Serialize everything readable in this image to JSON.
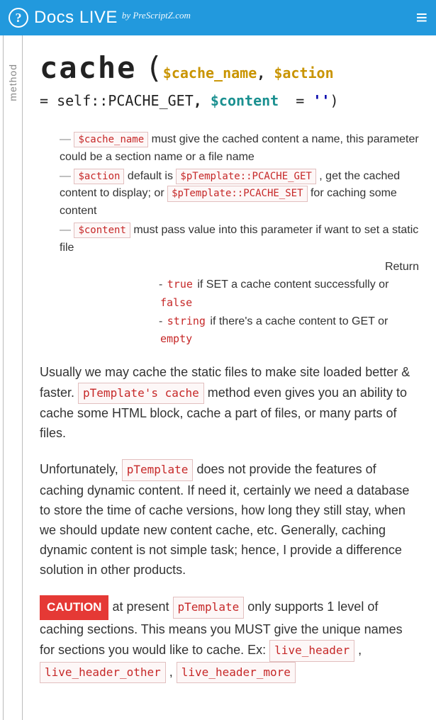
{
  "header": {
    "brand": "Docs LIVE",
    "byline": "by PreScriptZ.com",
    "question_glyph": "?",
    "menu_glyph": "≡"
  },
  "sidebar": {
    "label": "method"
  },
  "signature": {
    "name": "cache",
    "arg1": "$cache_name",
    "comma1": ",",
    "arg2": "$action",
    "eq1": "=",
    "self": "self::",
    "const1": "PCACHE_GET",
    "comma2": ",",
    "arg3": "$content",
    "eq2": "=",
    "strlit": "''",
    "close": ")"
  },
  "params": {
    "p1_code": "$cache_name",
    "p1_text": " must give the cached content a name, this parameter could be a section name or a file name",
    "p2_code": "$action",
    "p2_a": " default is ",
    "p2_code2": "$pTemplate::PCACHE_GET",
    "p2_b": " , get the cached content to display; or ",
    "p2_code3": "$pTemplate::PCACHE_SET",
    "p2_c": "  for caching some content",
    "p3_code": "$content",
    "p3_text": " must pass value into this parameter if want to set a static file"
  },
  "return": {
    "label": "Return",
    "r1_a": "true",
    "r1_b": " if SET a cache content successfully or ",
    "r1_c": "false",
    "r2_a": "string",
    "r2_b": " if there's a cache content to GET or ",
    "r2_c": "empty"
  },
  "para1_a": "Usually we may cache the static files to make site loaded better & faster. ",
  "para1_code": "pTemplate's cache",
  "para1_b": " method even gives you an ability to cache some HTML block, cache a part of files, or many parts of files.",
  "para2_a": "Unfortunately, ",
  "para2_code": "pTemplate",
  "para2_b": " does not provide the features of caching dynamic content. If need it, certainly we need a database to store the time of cache versions, how long they still stay, when we should update new content cache, etc. Generally, caching dynamic content is not simple task; hence, I provide a difference solution in other products.",
  "caution": {
    "badge": "CAUTION",
    "a": " at present ",
    "code1": "pTemplate",
    "b": " only supports 1 level of caching sections. This means you MUST give the unique names for sections you would like to cache. Ex: ",
    "code2": "live_header",
    "sep1": " , ",
    "code3": "live_header_other",
    "sep2": " , ",
    "code4": "live_header_more"
  }
}
